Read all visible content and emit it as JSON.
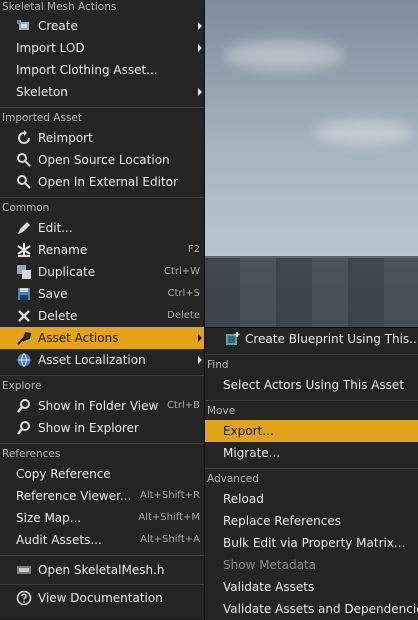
{
  "main_menu": {
    "sections": [
      {
        "header": "Skeletal Mesh Actions",
        "items": [
          {
            "label": "Create",
            "icon": "create-icon",
            "submenu": true
          },
          {
            "label": "Import LOD",
            "submenu": true
          },
          {
            "label": "Import Clothing Asset..."
          },
          {
            "label": "Skeleton",
            "submenu": true
          }
        ]
      },
      {
        "header": "Imported Asset",
        "items": [
          {
            "label": "Reimport",
            "icon": "reimport-icon"
          },
          {
            "label": "Open Source Location",
            "icon": "source-location-icon"
          },
          {
            "label": "Open In External Editor",
            "icon": "external-editor-icon"
          }
        ]
      },
      {
        "header": "Common",
        "items": [
          {
            "label": "Edit...",
            "icon": "edit-icon"
          },
          {
            "label": "Rename",
            "icon": "rename-icon",
            "shortcut": "F2"
          },
          {
            "label": "Duplicate",
            "icon": "duplicate-icon",
            "shortcut": "Ctrl+W"
          },
          {
            "label": "Save",
            "icon": "save-icon",
            "shortcut": "Ctrl+S"
          },
          {
            "label": "Delete",
            "icon": "delete-icon",
            "shortcut": "Delete"
          },
          {
            "label": "Asset Actions",
            "icon": "asset-actions-icon",
            "submenu": true,
            "highlighted": true
          },
          {
            "label": "Asset Localization",
            "icon": "localization-icon",
            "submenu": true
          }
        ]
      },
      {
        "header": "Explore",
        "items": [
          {
            "label": "Show in Folder View",
            "icon": "folder-search-icon",
            "shortcut": "Ctrl+B"
          },
          {
            "label": "Show in Explorer",
            "icon": "explorer-search-icon"
          }
        ]
      },
      {
        "header": "References",
        "items": [
          {
            "label": "Copy Reference"
          },
          {
            "label": "Reference Viewer...",
            "shortcut": "Alt+Shift+R"
          },
          {
            "label": "Size Map...",
            "shortcut": "Alt+Shift+M"
          },
          {
            "label": "Audit Assets...",
            "shortcut": "Alt+Shift+A"
          }
        ]
      }
    ],
    "bottom_items": [
      {
        "label": "Open SkeletalMesh.h",
        "icon": "code-file-icon"
      },
      {
        "label": "View Documentation",
        "icon": "help-icon"
      }
    ]
  },
  "sub_menu": {
    "top_item": {
      "label": "Create Blueprint Using This...",
      "icon": "blueprint-icon"
    },
    "sections": [
      {
        "header": "Find",
        "items": [
          {
            "label": "Select Actors Using This Asset"
          }
        ]
      },
      {
        "header": "Move",
        "items": [
          {
            "label": "Export...",
            "highlighted": true
          },
          {
            "label": "Migrate..."
          }
        ]
      },
      {
        "header": "Advanced",
        "items": [
          {
            "label": "Reload"
          },
          {
            "label": "Replace References"
          },
          {
            "label": "Bulk Edit via Property Matrix..."
          },
          {
            "label": "Show Metadata",
            "disabled": true
          },
          {
            "label": "Validate Assets"
          },
          {
            "label": "Validate Assets and Dependencies"
          }
        ]
      }
    ]
  },
  "colors": {
    "highlight": "#e2a318",
    "menu_bg": "#242424"
  }
}
